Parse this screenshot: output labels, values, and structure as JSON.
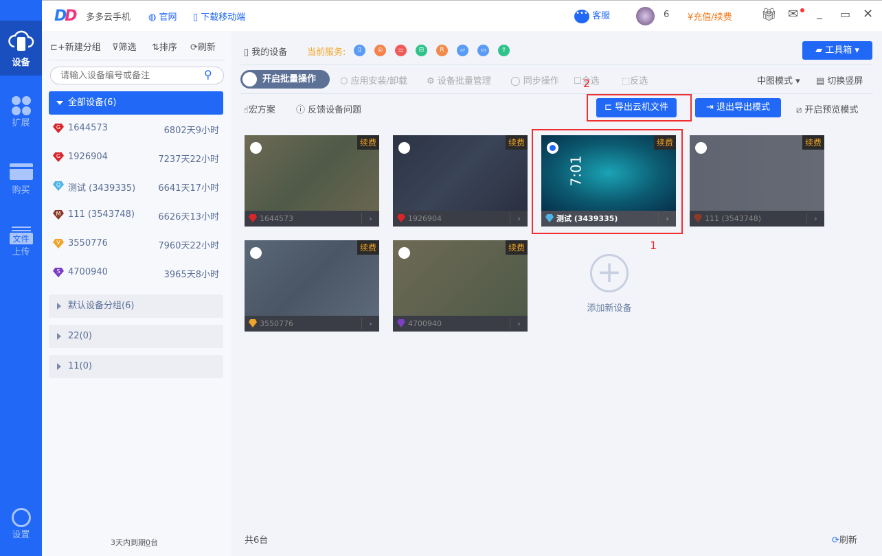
{
  "app": {
    "name": "多多云手机",
    "website": "官网",
    "download": "下载移动端",
    "service": "客服",
    "user_count": "6",
    "recharge": "充值/续费"
  },
  "nav": {
    "items": [
      {
        "label": "设备"
      },
      {
        "label": "扩展"
      },
      {
        "label": "购买"
      },
      {
        "label": "上传",
        "badge": "文件"
      }
    ],
    "settings": "设置"
  },
  "sidebar": {
    "new_group": "新建分组",
    "filter": "筛选",
    "sort": "排序",
    "refresh": "刷新",
    "search_placeholder": "请输入设备编号或备注",
    "all_devices": "全部设备(6)",
    "devices": [
      {
        "name": "1644573",
        "time": "6802天9小时",
        "level": "G",
        "color": "#d9262b"
      },
      {
        "name": "1926904",
        "time": "7237天22小时",
        "level": "G",
        "color": "#d9262b"
      },
      {
        "name": "测试 (3439335)",
        "time": "6641天17小时",
        "level": "Q",
        "color": "#4cb4e8"
      },
      {
        "name": "111 (3543748)",
        "time": "6626天13小时",
        "level": "M",
        "color": "#8b3a2a"
      },
      {
        "name": "3550776",
        "time": "7960天22小时",
        "level": "V",
        "color": "#f0a52a"
      },
      {
        "name": "4700940",
        "time": "3965天8小时",
        "level": "S",
        "color": "#7b3fc4"
      }
    ],
    "groups": [
      "默认设备分组(6)",
      "22(0)",
      "11(0)"
    ],
    "expiring_prefix": "3天内到期",
    "expiring_count": "0",
    "expiring_suffix": "台"
  },
  "main": {
    "my_devices": "我的设备",
    "current_service": "当前服务:",
    "services": [
      {
        "c": "#5a9cf5",
        "g": "▯"
      },
      {
        "c": "#f5814b",
        "g": "◎"
      },
      {
        "c": "#f25a5a",
        "g": "⚌"
      },
      {
        "c": "#2fc38a",
        "g": "⊟"
      },
      {
        "c": "#f5894b",
        "g": "R"
      },
      {
        "c": "#5a9cf5",
        "g": "▱"
      },
      {
        "c": "#5a9cf5",
        "g": "▭"
      },
      {
        "c": "#2fc38a",
        "g": "⇧"
      }
    ],
    "toolbox": "工具箱",
    "batch": "开启批量操作",
    "app_install": "应用安装/卸载",
    "batch_manage": "设备批量管理",
    "sync": "同步操作",
    "select_all": "全选",
    "invert": "反选",
    "view_mode": "中图模式",
    "switch_portrait": "切换竖屏",
    "macro": "宏方案",
    "feedback": "反馈设备问题",
    "export_files": "导出云机文件",
    "exit_export": "退出导出模式",
    "preview": "开启预览模式",
    "renew": "续费",
    "add_device": "添加新设备",
    "total": "共6台",
    "refresh": "刷新",
    "annot1": "1",
    "annot2": "2",
    "clock": "7:01"
  }
}
